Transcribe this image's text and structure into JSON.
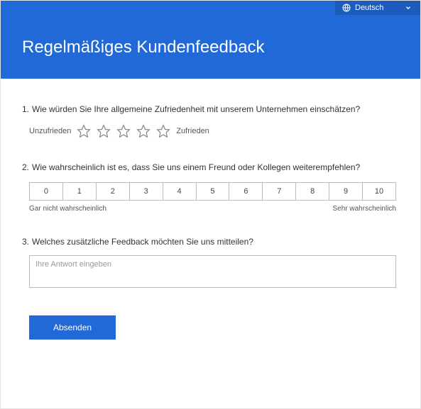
{
  "language": {
    "label": "Deutsch"
  },
  "title": "Regelmäßiges Kundenfeedback",
  "q1": {
    "num": "1.",
    "text": "Wie würden Sie Ihre allgemeine Zufriedenheit mit unserem Unternehmen einschätzen?",
    "low": "Unzufrieden",
    "high": "Zufrieden"
  },
  "q2": {
    "num": "2.",
    "text": "Wie wahrscheinlich ist es, dass Sie uns einem Freund oder Kollegen weiterempfehlen?",
    "low": "Gar nicht wahrscheinlich",
    "high": "Sehr wahrscheinlich",
    "options": [
      "0",
      "1",
      "2",
      "3",
      "4",
      "5",
      "6",
      "7",
      "8",
      "9",
      "10"
    ]
  },
  "q3": {
    "num": "3.",
    "text": "Welches zusätzliche Feedback möchten Sie uns mitteilen?",
    "placeholder": "Ihre Antwort eingeben"
  },
  "submit_label": "Absenden"
}
